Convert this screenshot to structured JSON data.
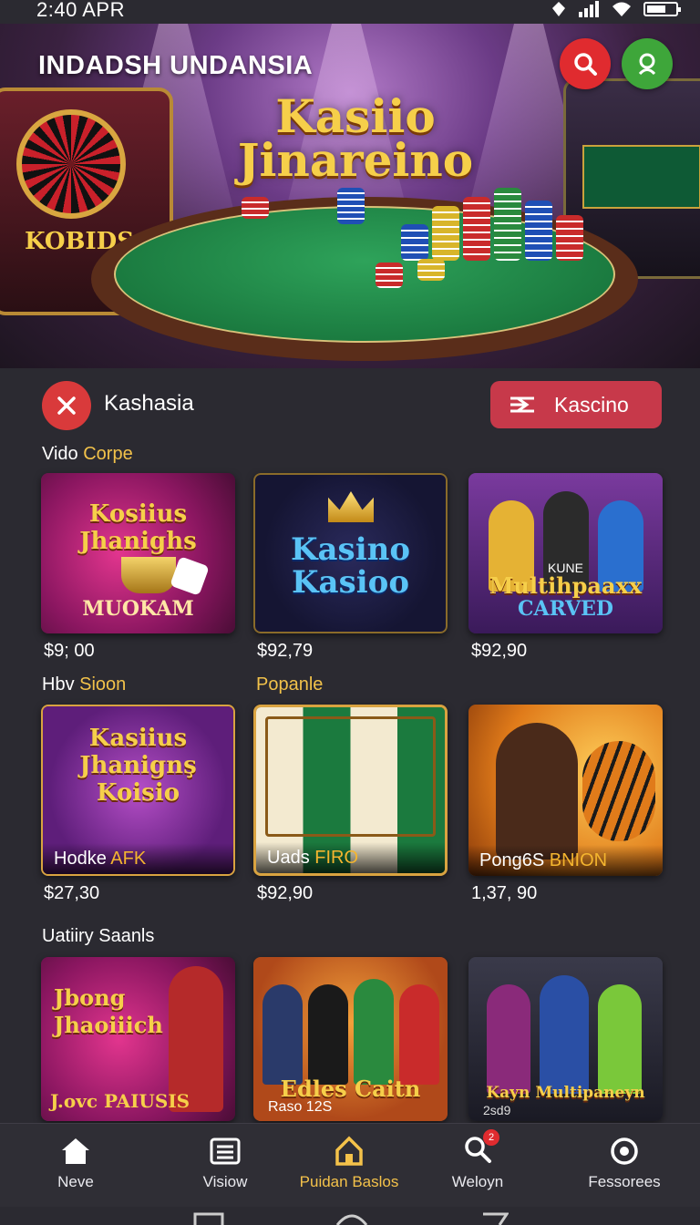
{
  "status_bar": {
    "time": "2:40 APR"
  },
  "hero": {
    "app_title": "INDADSH UNDANSIA",
    "logo_line1": "Kasiio",
    "logo_line2": "Jinareino",
    "machine_sign": "KOBIDS"
  },
  "action_row": {
    "chip_label": "Kashasia",
    "button_label": "Kascino"
  },
  "sections": [
    {
      "title": "Vido",
      "title_highlight": "Corpe"
    },
    {
      "title": "Hbv",
      "title_highlight": "Sioon"
    },
    {
      "title": "",
      "title_highlight": "Popanle"
    },
    {
      "title": "Uatiiry Saanls",
      "title_highlight": ""
    }
  ],
  "cards": [
    {
      "title": "Kosiius Jhanighs",
      "subtitle": "MUOKAM",
      "price": "$9; 00",
      "overlay": "",
      "overlay_hl": ""
    },
    {
      "title": "Kasino Kasioo",
      "subtitle": "",
      "price": "$92,79",
      "overlay": "",
      "overlay_hl": ""
    },
    {
      "title": "Multihpaaxx",
      "subtitle": "CARVED",
      "badge": "KUNE",
      "price": "$92,90",
      "overlay": "",
      "overlay_hl": ""
    },
    {
      "title": "Kasiius Jhanignş Koisio",
      "subtitle": "",
      "price": "$27,30",
      "overlay": "Hodke",
      "overlay_hl": "AFK"
    },
    {
      "title": "",
      "subtitle": "",
      "price": "$92,90",
      "overlay": "Uads",
      "overlay_hl": "FIRO"
    },
    {
      "title": "",
      "subtitle": "",
      "price": "1,37, 90",
      "overlay": "Pong6S",
      "overlay_hl": "BNION"
    },
    {
      "title": "Jbong Jhaoiiich",
      "subtitle": "J.ovc PAIUSIS",
      "price": "",
      "overlay": "",
      "overlay_hl": ""
    },
    {
      "title": "Edles Caitn",
      "subtitle": "Raso 12S",
      "price": "",
      "overlay": "",
      "overlay_hl": ""
    },
    {
      "title": "Kayn Multipaneyn",
      "subtitle": "2sd9",
      "price": "",
      "overlay": "",
      "overlay_hl": ""
    }
  ],
  "bottom_nav": [
    {
      "label": "Neve",
      "icon": "home-icon"
    },
    {
      "label": "Visiow",
      "icon": "list-icon"
    },
    {
      "label": "Puidan Baslos",
      "icon": "casino-home-icon"
    },
    {
      "label": "Weloyn",
      "icon": "search-icon",
      "badge": "2"
    },
    {
      "label": "Fessorees",
      "icon": "target-icon"
    }
  ],
  "colors": {
    "accent": "#f2c24a",
    "danger": "#d93a3b",
    "button": "#c7394a",
    "green": "#3ea63a",
    "background": "#2b2a31"
  }
}
